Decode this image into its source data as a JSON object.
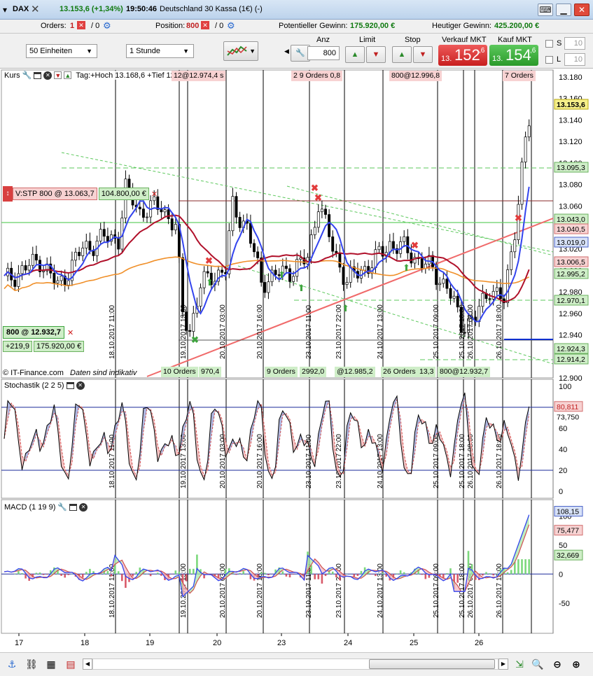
{
  "window": {
    "instrument": "DAX",
    "change": "13.153,6 (+1,34%)",
    "time": "19:50:46",
    "name": "Deutschland 30 Kassa (1€) (-)"
  },
  "info": {
    "orders_label": "Orders:",
    "orders_count": "1",
    "orders_sep": "/ 0",
    "position_label": "Position:",
    "position_value": "800",
    "position_sep": "/ 0",
    "pot_gain_label": "Potentieller Gewinn:",
    "pot_gain_value": "175.920,00 €",
    "today_gain_label": "Heutiger Gewinn:",
    "today_gain_value": "425.200,00 €"
  },
  "toolbar": {
    "units": "50 Einheiten",
    "interval": "1 Stunde",
    "anz_label": "Anz",
    "anz_value": "800",
    "limit_label": "Limit",
    "stop_label": "Stop",
    "sell_label": "Verkauf MKT",
    "buy_label": "Kauf MKT",
    "sell_prefix": "13.",
    "sell_main": "152",
    "sell_sup": ",6",
    "buy_prefix": "13.",
    "buy_main": "154",
    "buy_sup": ",6",
    "s_label": "S",
    "s_value": "10",
    "l_label": "L",
    "l_value": "10"
  },
  "main_panel": {
    "title": "Kurs",
    "legend": "Tag:+Hoch 13.168,6 +Tief 12.942,3",
    "credit": "© IT-Finance.com",
    "disclaimer": "Daten sind indikativ",
    "stop_tag": "V:STP 800 @ 13.063,7",
    "stop_gain": "104.800,00 €",
    "pos_tag": "800 @ 12.932,7",
    "pos_pts": "+219,9",
    "pos_gain": "175.920,00 €",
    "top_orders": [
      "12@12.974,4 s",
      "2 9 Orders 0,8",
      "800@12.996,8",
      "7 Orders"
    ],
    "bottom_orders": [
      "10 Orders",
      "970,4",
      "9 Orders",
      "2992,0",
      "@12.985,2",
      "26 Orders",
      "13,3",
      "800@12.932,7"
    ],
    "y_ticks": [
      "13.180",
      "13.160",
      "13.140",
      "13.120",
      "13.100",
      "13.080",
      "13.060",
      "13.040",
      "13.020",
      "13.000",
      "12.980",
      "12.960",
      "12.940",
      "12.920",
      "12.900"
    ],
    "price_tags": [
      {
        "label": "13.153,6",
        "cls": "yel"
      },
      {
        "label": "13.095,3",
        "cls": "grn"
      },
      {
        "label": "13.043,0",
        "cls": "grn"
      },
      {
        "label": "13.040,5",
        "cls": "red"
      },
      {
        "label": "13.019,0",
        "cls": "blu"
      },
      {
        "label": "13.006,5",
        "cls": "red"
      },
      {
        "label": "12.995,2",
        "cls": "grn"
      },
      {
        "label": "12.970,1",
        "cls": "grn"
      },
      {
        "label": "12.924,3",
        "cls": "grn"
      },
      {
        "label": "12.914,2",
        "cls": "grn"
      }
    ],
    "date_labels": [
      "18.10.2017 11:00",
      "19.10.2017 13:00",
      "20.10.2017 03:00",
      "20.10.2017 16:00",
      "23.10.2017 11:00",
      "23.10.2017 22:00",
      "24.10.2017 13:00",
      "25.10.2017 09:00",
      "25.10.2017 18:00",
      "26.10.2017 08:00",
      "26.10.2017 18:00"
    ]
  },
  "stoch_panel": {
    "title": "Stochastik (2 2 5)",
    "y_ticks": [
      "100",
      "80",
      "60",
      "40",
      "20",
      "0"
    ],
    "val1": "80,811",
    "val2": "73,750"
  },
  "macd_panel": {
    "title": "MACD (1 19 9)",
    "y_ticks": [
      "100",
      "50",
      "0",
      "-50"
    ],
    "val1": "108,15",
    "val2": "75,477",
    "val3": "32,669"
  },
  "x_axis": [
    "17",
    "18",
    "19",
    "20",
    "23",
    "24",
    "25",
    "26"
  ],
  "colors": {
    "candle": "#000000",
    "ma_blue": "#3344ee",
    "ma_red": "#b0102a",
    "ma_orange": "#f0902a",
    "trend_red": "#f06a6a",
    "trend_green": "#5cc85c",
    "sell": "#e23c3c",
    "buy": "#3ea43e"
  }
}
